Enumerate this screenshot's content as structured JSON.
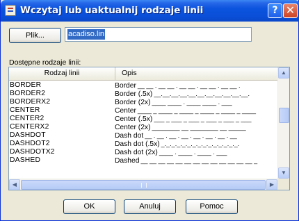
{
  "window": {
    "title": "Wczytaj lub uaktualnij rodzaje linii"
  },
  "file": {
    "button_label": "Plik...",
    "path_value": "acadiso.lin"
  },
  "list": {
    "label": "Dostępne rodzaje linii:",
    "columns": [
      "Rodzaj linii",
      "Opis"
    ],
    "rows": [
      {
        "name": "BORDER",
        "desc": "Border",
        "pattern": "__ __ . __ __ . __ __ . __ __ . __ __ ."
      },
      {
        "name": "BORDER2",
        "desc": "Border (.5x)",
        "pattern": "__.__.__.__.__.__.__.__.__.__.__."
      },
      {
        "name": "BORDERX2",
        "desc": "Border (2x)",
        "pattern": "____ ____ . ____ ____ . ___"
      },
      {
        "name": "CENTER",
        "desc": "Center",
        "pattern": "____ _ ____ _ ____ _ ____ _ ____ _ ____"
      },
      {
        "name": "CENTER2",
        "desc": "Center (.5x)",
        "pattern": "___ _ ___ _ ___ _ ___ _ ___ _ ___"
      },
      {
        "name": "CENTERX2",
        "desc": "Center (2x)",
        "pattern": "________ __ ________ __ _____"
      },
      {
        "name": "DASHDOT",
        "desc": "Dash dot",
        "pattern": "__ . __ . __ . __ . __ . __ . __ . __"
      },
      {
        "name": "DASHDOT2",
        "desc": "Dash dot (.5x)",
        "pattern": "_._._._._._._._._._._._._._._."
      },
      {
        "name": "DASHDOTX2",
        "desc": "Dash dot (2x)",
        "pattern": "____ . ____ . ____ . ___"
      },
      {
        "name": "DASHED",
        "desc": "Dashed",
        "pattern": "__ __ __ __ __ __ __ __ __ __ __ __ __ _"
      }
    ]
  },
  "buttons": {
    "ok": "OK",
    "cancel": "Anuluj",
    "help": "Pomoc"
  },
  "icons": {
    "app": "app-icon",
    "help": "help-icon",
    "close": "close-icon",
    "scroll_up": "arrow-up-icon",
    "scroll_down": "arrow-down-icon",
    "scroll_left": "arrow-left-icon",
    "scroll_right": "arrow-right-icon"
  },
  "colors": {
    "title_bar": "#0a4fd8",
    "selection": "#316ac5",
    "close_button": "#cc4224"
  }
}
